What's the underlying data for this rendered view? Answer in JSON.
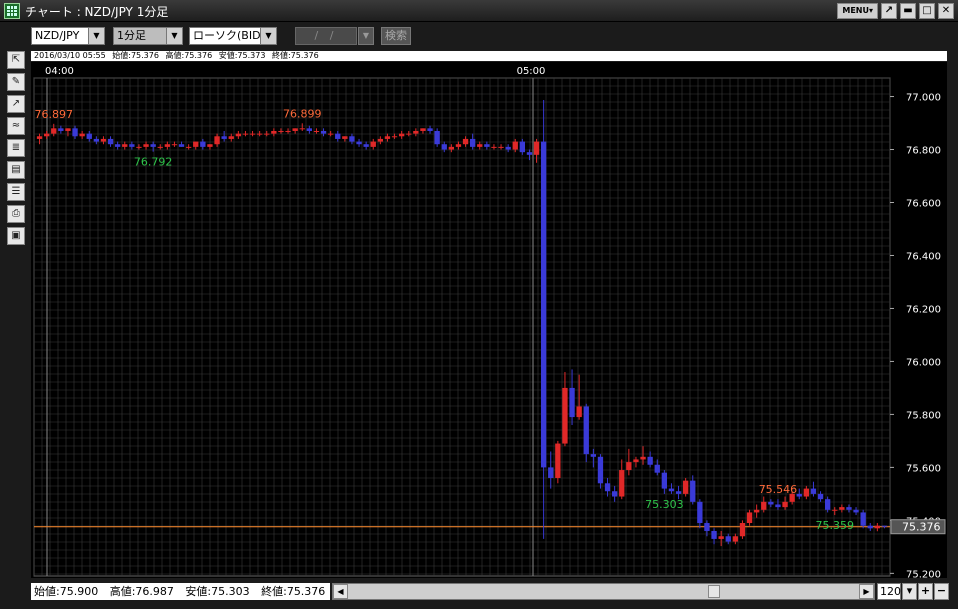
{
  "window": {
    "title": "チャート : NZD/JPY 1分足",
    "menu_label": "MENU▾",
    "buttons": {
      "detach": "↗",
      "minimize": "▬",
      "maximize": "□",
      "close": "✕"
    }
  },
  "toolbar": {
    "symbol": "NZD/JPY",
    "timeframe": "1分足",
    "chart_type": "ローソク(BID)",
    "date_placeholder": "/ /",
    "search_label": "検索"
  },
  "sidebar_icons": [
    "cursor-icon",
    "pen-icon",
    "indicator-icon",
    "oscillator-icon",
    "price-icon",
    "sheet-icon",
    "list-icon",
    "print-icon",
    "save-icon"
  ],
  "info_bar": {
    "datetime": "2016/03/10 05:55",
    "open": "始値:75.376",
    "high": "高値:75.376",
    "low": "安値:75.373",
    "close": "終値:75.376"
  },
  "status_bar": {
    "open": "始値:75.900",
    "high": "高値:76.987",
    "low": "安値:75.303",
    "close": "終値:75.376"
  },
  "zoom": "120",
  "colors": {
    "up": "#e02828",
    "down": "#3a3ad8",
    "grid": "#3a3a3a",
    "high_label": "#ff6a3a",
    "low_label": "#2ec44a",
    "price_line": "#ff8a2a"
  },
  "chart_data": {
    "type": "candlestick",
    "y_ticks": [
      "77.000",
      "76.800",
      "76.600",
      "76.400",
      "76.200",
      "76.000",
      "75.800",
      "75.600",
      "75.400",
      "75.200"
    ],
    "ylim": [
      75.19,
      77.07
    ],
    "x_labels": [
      "04:00",
      "05:00"
    ],
    "current_price": "75.376",
    "annotations": [
      {
        "text": "76.897",
        "kind": "high",
        "index": 2
      },
      {
        "text": "76.899",
        "kind": "high",
        "index": 37
      },
      {
        "text": "76.792",
        "kind": "low",
        "index": 16
      },
      {
        "text": "75.303",
        "kind": "low",
        "index": 88
      },
      {
        "text": "75.546",
        "kind": "high",
        "index": 104
      },
      {
        "text": "75.359",
        "kind": "low",
        "index": 112
      }
    ],
    "candles": [
      {
        "o": 76.84,
        "h": 76.86,
        "l": 76.82,
        "c": 76.85
      },
      {
        "o": 76.85,
        "h": 76.87,
        "l": 76.84,
        "c": 76.86
      },
      {
        "o": 76.86,
        "h": 76.897,
        "l": 76.85,
        "c": 76.88
      },
      {
        "o": 76.88,
        "h": 76.89,
        "l": 76.86,
        "c": 76.87
      },
      {
        "o": 76.87,
        "h": 76.88,
        "l": 76.85,
        "c": 76.88
      },
      {
        "o": 76.88,
        "h": 76.89,
        "l": 76.84,
        "c": 76.85
      },
      {
        "o": 76.85,
        "h": 76.87,
        "l": 76.84,
        "c": 76.86
      },
      {
        "o": 76.86,
        "h": 76.87,
        "l": 76.83,
        "c": 76.84
      },
      {
        "o": 76.84,
        "h": 76.85,
        "l": 76.82,
        "c": 76.83
      },
      {
        "o": 76.83,
        "h": 76.85,
        "l": 76.82,
        "c": 76.84
      },
      {
        "o": 76.84,
        "h": 76.85,
        "l": 76.81,
        "c": 76.82
      },
      {
        "o": 76.82,
        "h": 76.83,
        "l": 76.8,
        "c": 76.81
      },
      {
        "o": 76.81,
        "h": 76.83,
        "l": 76.8,
        "c": 76.82
      },
      {
        "o": 76.82,
        "h": 76.83,
        "l": 76.8,
        "c": 76.81
      },
      {
        "o": 76.81,
        "h": 76.82,
        "l": 76.8,
        "c": 76.81
      },
      {
        "o": 76.81,
        "h": 76.83,
        "l": 76.8,
        "c": 76.82
      },
      {
        "o": 76.82,
        "h": 76.83,
        "l": 76.792,
        "c": 76.81
      },
      {
        "o": 76.81,
        "h": 76.82,
        "l": 76.8,
        "c": 76.81
      },
      {
        "o": 76.81,
        "h": 76.83,
        "l": 76.8,
        "c": 76.82
      },
      {
        "o": 76.82,
        "h": 76.83,
        "l": 76.81,
        "c": 76.82
      },
      {
        "o": 76.82,
        "h": 76.83,
        "l": 76.81,
        "c": 76.81
      },
      {
        "o": 76.81,
        "h": 76.82,
        "l": 76.8,
        "c": 76.81
      },
      {
        "o": 76.81,
        "h": 76.83,
        "l": 76.8,
        "c": 76.83
      },
      {
        "o": 76.83,
        "h": 76.84,
        "l": 76.8,
        "c": 76.81
      },
      {
        "o": 76.81,
        "h": 76.82,
        "l": 76.8,
        "c": 76.82
      },
      {
        "o": 76.82,
        "h": 76.86,
        "l": 76.81,
        "c": 76.85
      },
      {
        "o": 76.85,
        "h": 76.87,
        "l": 76.83,
        "c": 76.84
      },
      {
        "o": 76.84,
        "h": 76.86,
        "l": 76.83,
        "c": 76.85
      },
      {
        "o": 76.85,
        "h": 76.87,
        "l": 76.84,
        "c": 76.86
      },
      {
        "o": 76.86,
        "h": 76.87,
        "l": 76.85,
        "c": 76.86
      },
      {
        "o": 76.86,
        "h": 76.87,
        "l": 76.85,
        "c": 76.86
      },
      {
        "o": 76.86,
        "h": 76.87,
        "l": 76.85,
        "c": 76.86
      },
      {
        "o": 76.86,
        "h": 76.87,
        "l": 76.85,
        "c": 76.86
      },
      {
        "o": 76.86,
        "h": 76.88,
        "l": 76.85,
        "c": 76.87
      },
      {
        "o": 76.87,
        "h": 76.88,
        "l": 76.86,
        "c": 76.87
      },
      {
        "o": 76.87,
        "h": 76.88,
        "l": 76.86,
        "c": 76.87
      },
      {
        "o": 76.87,
        "h": 76.88,
        "l": 76.86,
        "c": 76.88
      },
      {
        "o": 76.88,
        "h": 76.899,
        "l": 76.87,
        "c": 76.88
      },
      {
        "o": 76.88,
        "h": 76.89,
        "l": 76.86,
        "c": 76.87
      },
      {
        "o": 76.87,
        "h": 76.88,
        "l": 76.86,
        "c": 76.87
      },
      {
        "o": 76.87,
        "h": 76.88,
        "l": 76.85,
        "c": 76.86
      },
      {
        "o": 76.86,
        "h": 76.87,
        "l": 76.85,
        "c": 76.86
      },
      {
        "o": 76.86,
        "h": 76.87,
        "l": 76.83,
        "c": 76.84
      },
      {
        "o": 76.84,
        "h": 76.85,
        "l": 76.83,
        "c": 76.85
      },
      {
        "o": 76.85,
        "h": 76.86,
        "l": 76.82,
        "c": 76.83
      },
      {
        "o": 76.83,
        "h": 76.84,
        "l": 76.81,
        "c": 76.82
      },
      {
        "o": 76.82,
        "h": 76.83,
        "l": 76.8,
        "c": 76.81
      },
      {
        "o": 76.81,
        "h": 76.84,
        "l": 76.8,
        "c": 76.83
      },
      {
        "o": 76.83,
        "h": 76.85,
        "l": 76.82,
        "c": 76.84
      },
      {
        "o": 76.84,
        "h": 76.86,
        "l": 76.83,
        "c": 76.85
      },
      {
        "o": 76.85,
        "h": 76.86,
        "l": 76.84,
        "c": 76.85
      },
      {
        "o": 76.85,
        "h": 76.87,
        "l": 76.84,
        "c": 76.86
      },
      {
        "o": 76.86,
        "h": 76.87,
        "l": 76.85,
        "c": 76.86
      },
      {
        "o": 76.86,
        "h": 76.88,
        "l": 76.85,
        "c": 76.87
      },
      {
        "o": 76.87,
        "h": 76.88,
        "l": 76.86,
        "c": 76.88
      },
      {
        "o": 76.88,
        "h": 76.89,
        "l": 76.86,
        "c": 76.87
      },
      {
        "o": 76.87,
        "h": 76.88,
        "l": 76.81,
        "c": 76.82
      },
      {
        "o": 76.82,
        "h": 76.83,
        "l": 76.79,
        "c": 76.8
      },
      {
        "o": 76.8,
        "h": 76.82,
        "l": 76.79,
        "c": 76.81
      },
      {
        "o": 76.81,
        "h": 76.83,
        "l": 76.8,
        "c": 76.82
      },
      {
        "o": 76.82,
        "h": 76.85,
        "l": 76.81,
        "c": 76.84
      },
      {
        "o": 76.84,
        "h": 76.86,
        "l": 76.8,
        "c": 76.81
      },
      {
        "o": 76.81,
        "h": 76.83,
        "l": 76.8,
        "c": 76.82
      },
      {
        "o": 76.82,
        "h": 76.83,
        "l": 76.8,
        "c": 76.81
      },
      {
        "o": 76.81,
        "h": 76.82,
        "l": 76.8,
        "c": 76.81
      },
      {
        "o": 76.81,
        "h": 76.82,
        "l": 76.8,
        "c": 76.81
      },
      {
        "o": 76.81,
        "h": 76.82,
        "l": 76.79,
        "c": 76.8
      },
      {
        "o": 76.8,
        "h": 76.84,
        "l": 76.79,
        "c": 76.83
      },
      {
        "o": 76.83,
        "h": 76.84,
        "l": 76.78,
        "c": 76.79
      },
      {
        "o": 76.79,
        "h": 76.8,
        "l": 76.76,
        "c": 76.78
      },
      {
        "o": 76.78,
        "h": 76.84,
        "l": 76.75,
        "c": 76.83
      },
      {
        "o": 76.83,
        "h": 76.987,
        "l": 75.33,
        "c": 75.6
      },
      {
        "o": 75.6,
        "h": 75.66,
        "l": 75.52,
        "c": 75.56
      },
      {
        "o": 75.56,
        "h": 75.7,
        "l": 75.54,
        "c": 75.69
      },
      {
        "o": 75.69,
        "h": 75.96,
        "l": 75.68,
        "c": 75.9
      },
      {
        "o": 75.9,
        "h": 75.97,
        "l": 75.76,
        "c": 75.79
      },
      {
        "o": 75.79,
        "h": 75.95,
        "l": 75.78,
        "c": 75.83
      },
      {
        "o": 75.83,
        "h": 75.84,
        "l": 75.62,
        "c": 75.65
      },
      {
        "o": 75.65,
        "h": 75.67,
        "l": 75.6,
        "c": 75.64
      },
      {
        "o": 75.64,
        "h": 75.65,
        "l": 75.52,
        "c": 75.54
      },
      {
        "o": 75.54,
        "h": 75.56,
        "l": 75.49,
        "c": 75.51
      },
      {
        "o": 75.51,
        "h": 75.53,
        "l": 75.47,
        "c": 75.49
      },
      {
        "o": 75.49,
        "h": 75.63,
        "l": 75.48,
        "c": 75.59
      },
      {
        "o": 75.59,
        "h": 75.67,
        "l": 75.57,
        "c": 75.62
      },
      {
        "o": 75.62,
        "h": 75.64,
        "l": 75.6,
        "c": 75.63
      },
      {
        "o": 75.63,
        "h": 75.68,
        "l": 75.61,
        "c": 75.64
      },
      {
        "o": 75.64,
        "h": 75.66,
        "l": 75.6,
        "c": 75.61
      },
      {
        "o": 75.61,
        "h": 75.63,
        "l": 75.57,
        "c": 75.58
      },
      {
        "o": 75.58,
        "h": 75.59,
        "l": 75.5,
        "c": 75.52
      },
      {
        "o": 75.52,
        "h": 75.54,
        "l": 75.5,
        "c": 75.51
      },
      {
        "o": 75.51,
        "h": 75.53,
        "l": 75.48,
        "c": 75.5
      },
      {
        "o": 75.5,
        "h": 75.56,
        "l": 75.49,
        "c": 75.55
      },
      {
        "o": 75.55,
        "h": 75.57,
        "l": 75.46,
        "c": 75.47
      },
      {
        "o": 75.47,
        "h": 75.48,
        "l": 75.37,
        "c": 75.39
      },
      {
        "o": 75.39,
        "h": 75.4,
        "l": 75.34,
        "c": 75.36
      },
      {
        "o": 75.36,
        "h": 75.37,
        "l": 75.31,
        "c": 75.33
      },
      {
        "o": 75.33,
        "h": 75.36,
        "l": 75.303,
        "c": 75.34
      },
      {
        "o": 75.34,
        "h": 75.35,
        "l": 75.31,
        "c": 75.32
      },
      {
        "o": 75.32,
        "h": 75.35,
        "l": 75.31,
        "c": 75.34
      },
      {
        "o": 75.34,
        "h": 75.4,
        "l": 75.33,
        "c": 75.39
      },
      {
        "o": 75.39,
        "h": 75.44,
        "l": 75.38,
        "c": 75.43
      },
      {
        "o": 75.43,
        "h": 75.46,
        "l": 75.41,
        "c": 75.44
      },
      {
        "o": 75.44,
        "h": 75.49,
        "l": 75.43,
        "c": 75.47
      },
      {
        "o": 75.47,
        "h": 75.48,
        "l": 75.45,
        "c": 75.46
      },
      {
        "o": 75.46,
        "h": 75.48,
        "l": 75.44,
        "c": 75.45
      },
      {
        "o": 75.45,
        "h": 75.49,
        "l": 75.44,
        "c": 75.47
      },
      {
        "o": 75.47,
        "h": 75.51,
        "l": 75.46,
        "c": 75.5
      },
      {
        "o": 75.5,
        "h": 75.52,
        "l": 75.48,
        "c": 75.49
      },
      {
        "o": 75.49,
        "h": 75.53,
        "l": 75.48,
        "c": 75.52
      },
      {
        "o": 75.52,
        "h": 75.546,
        "l": 75.49,
        "c": 75.5
      },
      {
        "o": 75.5,
        "h": 75.51,
        "l": 75.47,
        "c": 75.48
      },
      {
        "o": 75.48,
        "h": 75.49,
        "l": 75.43,
        "c": 75.44
      },
      {
        "o": 75.44,
        "h": 75.45,
        "l": 75.42,
        "c": 75.44
      },
      {
        "o": 75.44,
        "h": 75.46,
        "l": 75.43,
        "c": 75.45
      },
      {
        "o": 75.45,
        "h": 75.46,
        "l": 75.43,
        "c": 75.44
      },
      {
        "o": 75.44,
        "h": 75.45,
        "l": 75.42,
        "c": 75.43
      },
      {
        "o": 75.43,
        "h": 75.44,
        "l": 75.37,
        "c": 75.38
      },
      {
        "o": 75.38,
        "h": 75.39,
        "l": 75.36,
        "c": 75.37
      },
      {
        "o": 75.37,
        "h": 75.39,
        "l": 75.359,
        "c": 75.38
      },
      {
        "o": 75.38,
        "h": 75.38,
        "l": 75.37,
        "c": 75.376
      }
    ]
  }
}
